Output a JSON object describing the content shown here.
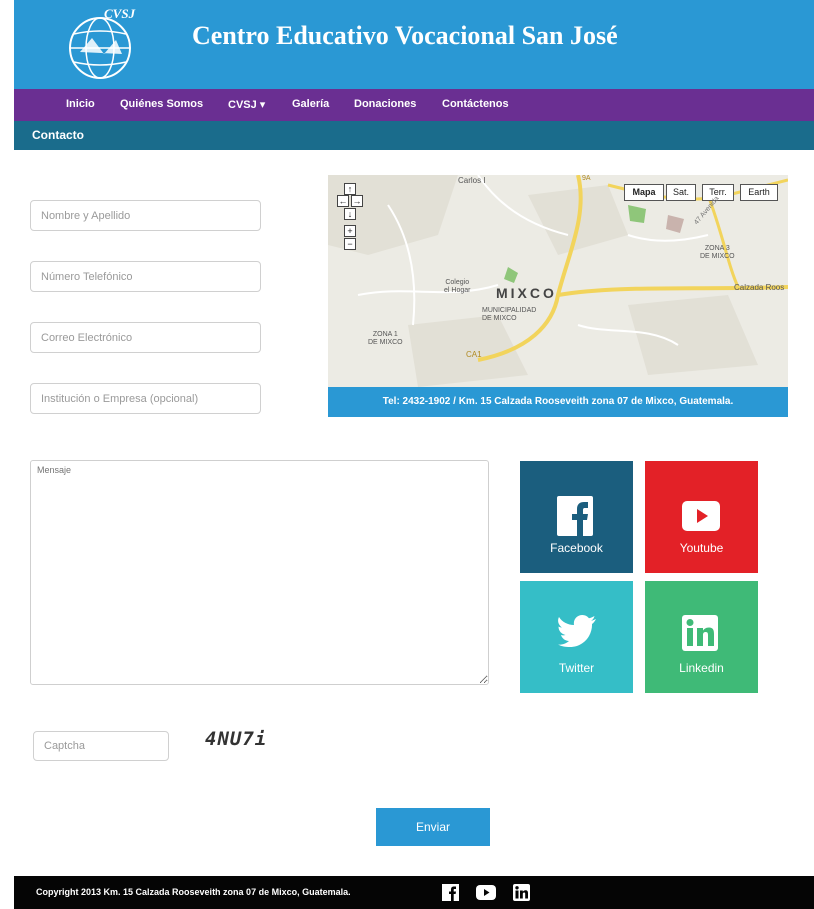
{
  "header": {
    "title": "Centro Educativo Vocacional San José",
    "logo_text": "CVSJ"
  },
  "nav": {
    "items": [
      "Inicio",
      "Quiénes Somos",
      "CVSJ ▾",
      "Galería",
      "Donaciones",
      "Contáctenos"
    ]
  },
  "page": {
    "title": "Contacto"
  },
  "form": {
    "name_placeholder": "Nombre y Apellido",
    "phone_placeholder": "Número Telefónico",
    "email_placeholder": "Correo Electrónico",
    "org_placeholder": "Institución o Empresa (opcional)",
    "message_placeholder": "Mensaje",
    "captcha_placeholder": "Captcha",
    "captcha_text": "4NU7i",
    "submit_label": "Enviar"
  },
  "map": {
    "buttons": [
      "Mapa",
      "Sat.",
      "Terr.",
      "Earth"
    ],
    "active_button": "Mapa",
    "labels": {
      "city": "MIXCO",
      "colegio": "Colegio\nel Hogar",
      "municipalidad": "MUNICIPALIDAD\nDE MIXCO",
      "zona1": "ZONA 1\nDE MIXCO",
      "zona3": "ZONA 3\nDE MIXCO",
      "carlos": "Carlos I",
      "calzada": "Calzada Roos",
      "avenida": "47 Avenida",
      "ca1": "CA1",
      "route": "9A"
    },
    "info": "Tel: 2432-1902 / Km. 15 Calzada Rooseveith zona 07 de Mixco, Guatemala."
  },
  "social": [
    {
      "label": "Facebook",
      "color": "#1b5e7e",
      "icon": "facebook-icon"
    },
    {
      "label": "Youtube",
      "color": "#e32127",
      "icon": "youtube-icon"
    },
    {
      "label": "Twitter",
      "color": "#35bec7",
      "icon": "twitter-icon"
    },
    {
      "label": "Linkedin",
      "color": "#3fba77",
      "icon": "linkedin-icon"
    }
  ],
  "footer": {
    "copyright": "Copyright 2013 Km. 15 Calzada Rooseveith zona 07 de Mixco, Guatemala."
  },
  "colors": {
    "header": "#2a98d4",
    "nav": "#6a2f92",
    "subbar": "#1a6c8c",
    "footer": "#050505"
  }
}
